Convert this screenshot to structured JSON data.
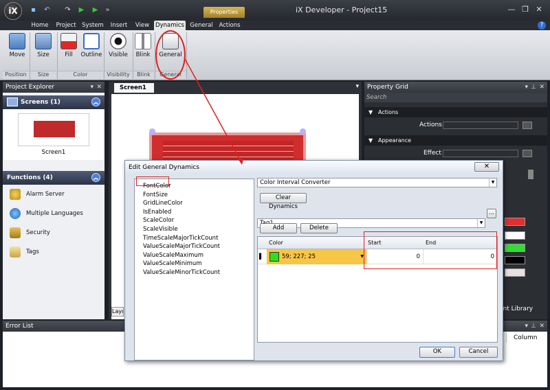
{
  "app": {
    "logo": "iX",
    "title": "iX Developer - Project15",
    "contextual_tab_group": "Properties"
  },
  "ribbon_tabs": [
    "Home",
    "Project",
    "System",
    "Insert",
    "View",
    "Dynamics",
    "General",
    "Actions"
  ],
  "ribbon": {
    "buttons": [
      "Move",
      "Size",
      "Fill",
      "Outline",
      "Visible",
      "Blink",
      "General"
    ],
    "groups": [
      "Position",
      "Size",
      "Color",
      "Visibility",
      "Blink",
      "General"
    ]
  },
  "project_explorer": {
    "title": "Project Explorer",
    "screens_header": "Screens (1)",
    "screen_name": "Screen1",
    "functions_header": "Functions (4)",
    "functions": [
      "Alarm Server",
      "Multiple Languages",
      "Security",
      "Tags"
    ]
  },
  "editor": {
    "tab": "Screen1",
    "bottom_tab": "Layo"
  },
  "property_grid": {
    "title": "Property Grid",
    "search_placeholder": "Search",
    "sections": [
      "Actions",
      "Appearance"
    ],
    "rows": [
      "Actions",
      "Effect"
    ],
    "component_library": "ent Library",
    "swatches": [
      "#e03030",
      "#ffffff",
      "#33dd33",
      "#000000",
      "#e8e0e0"
    ]
  },
  "error_list": {
    "title": "Error List",
    "column": "Column"
  },
  "dialog": {
    "title": "Edit General Dynamics",
    "properties": [
      "FontColor",
      "FontSize",
      "GridLineColor",
      "IsEnabled",
      "ScaleColor",
      "ScaleVisible",
      "TimeScaleMajorTickCount",
      "ValueScaleMajorTickCount",
      "ValueScaleMaximum",
      "ValueScaleMinimum",
      "ValueScaleMinorTickCount"
    ],
    "converter": "Color Interval Converter",
    "clear_label": "Clear Dynamics",
    "tag": "Tag1",
    "browse_label": "...",
    "add_label": "Add",
    "delete_label": "Delete",
    "columns": {
      "color": "Color",
      "start": "Start",
      "end": "End"
    },
    "row": {
      "color_hex": "#33dd19",
      "color_text": "59; 227; 25",
      "start": "0",
      "end": "0"
    },
    "ok_label": "OK",
    "cancel_label": "Cancel"
  }
}
